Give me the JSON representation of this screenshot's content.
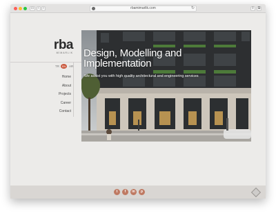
{
  "browser": {
    "url": "rbamimarlik.com",
    "back_glyph": "‹",
    "forward_glyph": "›",
    "sidebar_glyph": "▭",
    "reload_glyph": "↻",
    "share_glyph": "⇧",
    "tabs_glyph": "⧉"
  },
  "brand": {
    "logo_text": "rba",
    "tagline": "MİMARLIK"
  },
  "language": {
    "left": "TR",
    "current": "EN",
    "right": "AR"
  },
  "nav": {
    "items": [
      "Home",
      "About",
      "Projects",
      "Career",
      "Contact"
    ]
  },
  "hero": {
    "title_line1": "Design, Modelling and",
    "title_line2": "Implementation",
    "subtitle": "We assist you with high quality architectural and engineering services"
  },
  "footer": {
    "social_glyphs": [
      "t",
      "f",
      "in",
      "p"
    ]
  },
  "colors": {
    "accent": "#c9573c",
    "social": "#bf7a63"
  }
}
